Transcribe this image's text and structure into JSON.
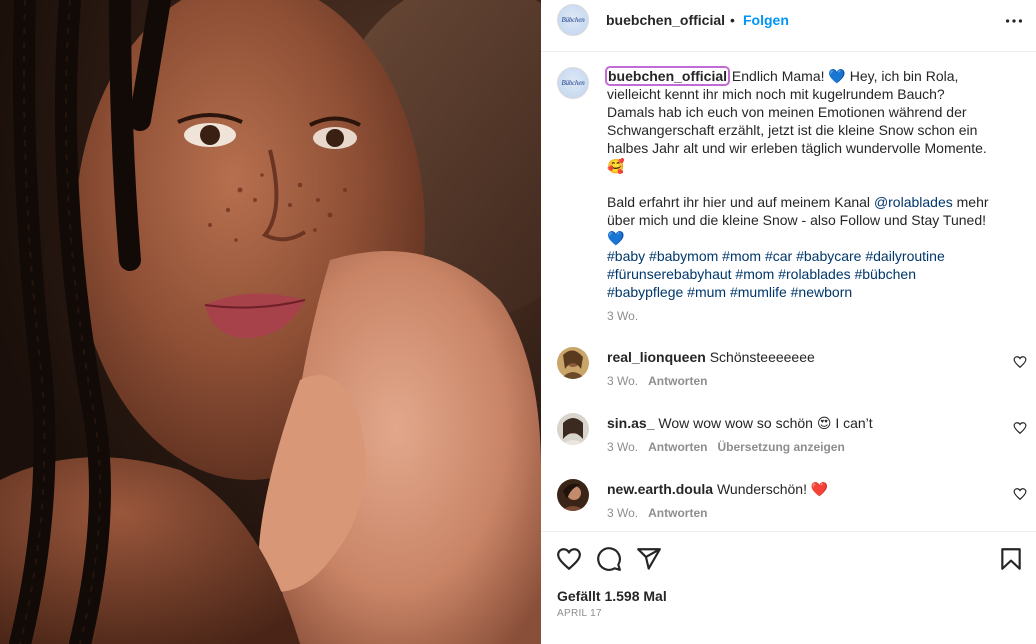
{
  "post": {
    "author": "buebchen_official",
    "separator": "•",
    "follow_label": "Folgen",
    "avatar_logo_text": "Bübchen",
    "caption_text_1": " Endlich Mama! 💙 Hey, ich bin Rola,\nvielleicht kennt ihr mich noch mit kugelrundem Bauch?\nDamals hab ich euch von meinen Emotionen während der\nSchwangerschaft erzählt, jetzt ist die kleine Snow schon ein\nhalbes Jahr alt und wir erleben täglich wundervolle Momente.\n🥰\n\nBald erfahrt ihr hier und auf meinem Kanal ",
    "caption_mention": "@rolablades",
    "caption_text_2": " mehr\nüber mich und die kleine Snow - also Follow und Stay Tuned!\n💙\n",
    "hashtags_line_1": "#baby #babymom #mom #car #babycare #dailyroutine",
    "hashtags_line_2": "#fürunserebabyhaut #mom #rolablades #bübchen",
    "hashtags_line_3": "#babypflege #mum #mumlife #newborn",
    "caption_time": "3 Wo.",
    "likes": "Gefällt 1.598 Mal",
    "date": "April 17"
  },
  "comments": [
    {
      "user": "real_lionqueen",
      "text": "Schönsteeeeeee",
      "time": "3 Wo.",
      "reply": "Antworten",
      "translate": ""
    },
    {
      "user": "sin.as_",
      "text": "Wow wow wow so schön 😍 I can’t",
      "time": "3 Wo.",
      "reply": "Antworten",
      "translate": "Übersetzung anzeigen"
    },
    {
      "user": "new.earth.doula",
      "text": "Wunderschön! ❤️",
      "time": "3 Wo.",
      "reply": "Antworten",
      "translate": ""
    }
  ],
  "icons": {
    "more": "more-options-icon",
    "like": "heart-icon",
    "comment": "comment-icon",
    "share": "share-icon",
    "save": "bookmark-icon",
    "comment_like": "heart-icon"
  },
  "colors": {
    "accent_blue": "#0095f6",
    "hashtag": "#00376b",
    "muted": "#8e8e8e",
    "highlight_outline": "#c26bd4"
  }
}
